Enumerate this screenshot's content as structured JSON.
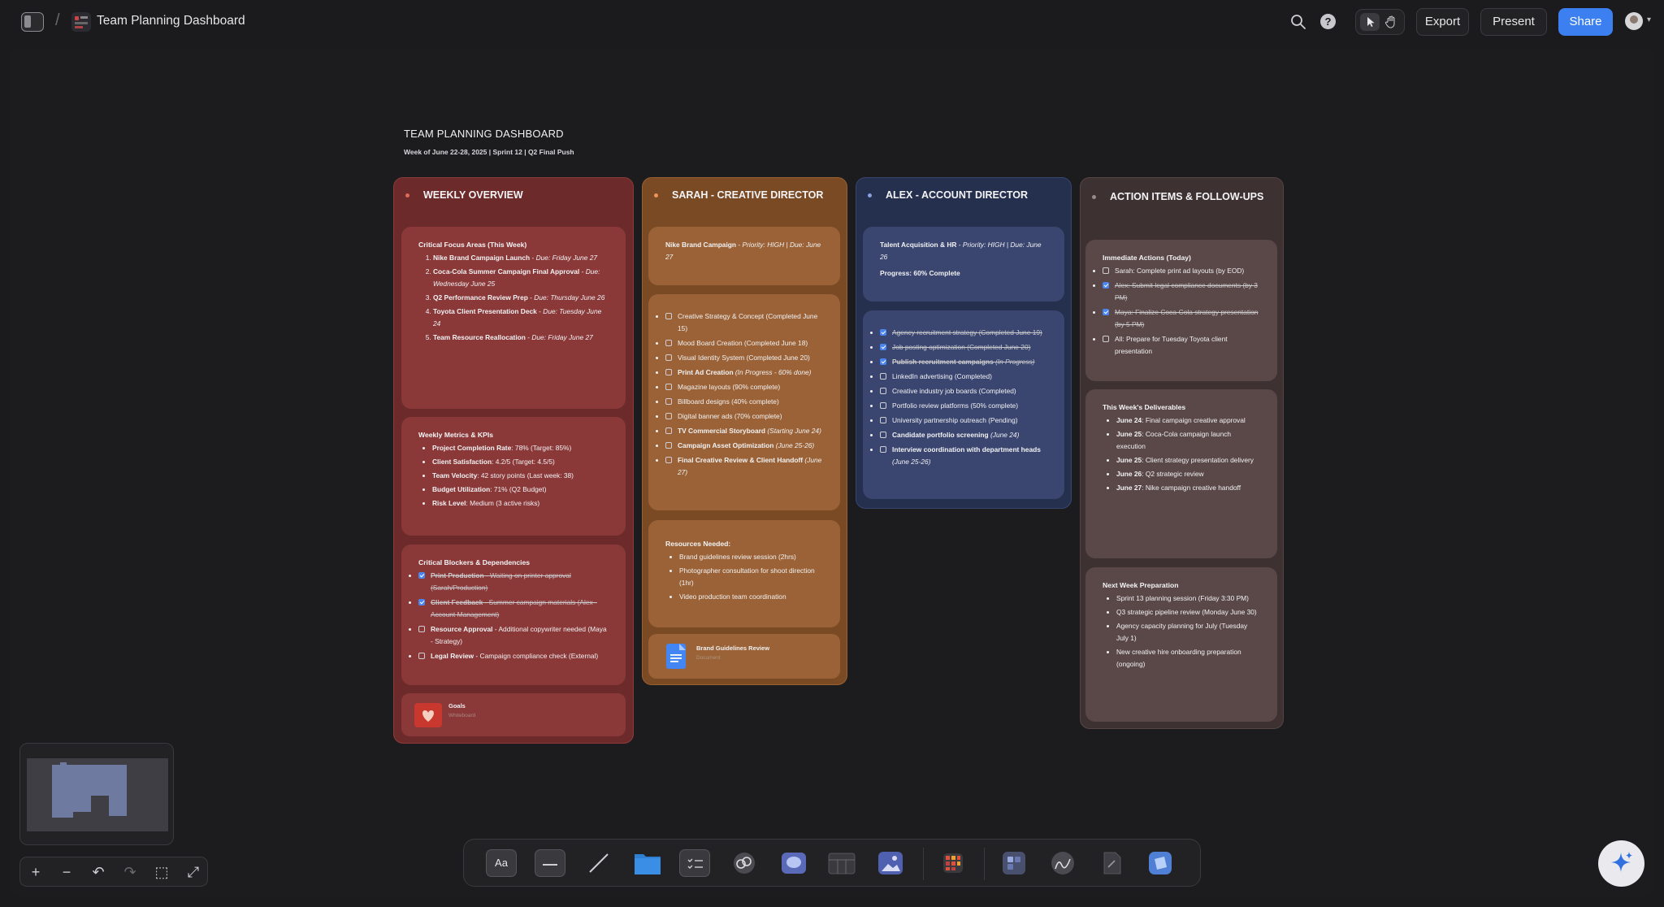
{
  "topbar": {
    "title": "Team Planning Dashboard",
    "export_label": "Export",
    "present_label": "Present",
    "share_label": "Share",
    "icons": [
      "sidebar-toggle-icon",
      "file-thumbnail-icon",
      "search-icon",
      "help-icon",
      "pointer-icon",
      "hand-icon",
      "avatar",
      "chevron-down-icon"
    ]
  },
  "doc": {
    "title": "TEAM PLANNING DASHBOARD",
    "subtitle": "Week of June 22-28, 2025 | Sprint 12 | Q2 Final Push"
  },
  "columns": {
    "weekly": {
      "header": "WEEKLY OVERVIEW",
      "color": "#6e2a2a",
      "card1": {
        "heading": "Critical Focus Areas (This Week)",
        "items": [
          {
            "bold": "Nike Brand Campaign Launch",
            "sep": " - ",
            "ital": "Due: Friday June 27"
          },
          {
            "bold": "Coca-Cola Summer Campaign Final Approval",
            "sep": " - ",
            "ital": "Due: Wednesday June 25"
          },
          {
            "bold": "Q2 Performance Review Prep",
            "sep": " - ",
            "ital": "Due: Thursday June 26"
          },
          {
            "bold": "Toyota Client Presentation Deck",
            "sep": " - ",
            "ital": "Due: Tuesday June 24"
          },
          {
            "bold": "Team Resource Reallocation",
            "sep": " - ",
            "ital": "Due: Friday June 27"
          }
        ]
      },
      "card2": {
        "heading": "Weekly Metrics & KPIs",
        "items": [
          {
            "bold": "Project Completion Rate",
            "rest": ": 78% (Target: 85%)"
          },
          {
            "bold": "Client Satisfaction",
            "rest": ": 4.2/5 (Target: 4.5/5)"
          },
          {
            "bold": "Team Velocity",
            "rest": ": 42 story points (Last week: 38)"
          },
          {
            "bold": "Budget Utilization",
            "rest": ": 71% (Q2 Budget)"
          },
          {
            "bold": "Risk Level",
            "rest": ": Medium (3 active risks)"
          }
        ]
      },
      "card3": {
        "heading": "Critical Blockers & Dependencies",
        "items": [
          {
            "bold": "Print Production",
            "rest": " - Waiting on printer approval (Sarah/Production)",
            "done": true
          },
          {
            "bold": "Client Feedback",
            "rest": " - Summer campaign materials (Alex - Account Management)",
            "done": true
          },
          {
            "bold": "Resource Approval",
            "rest": " - Additional copywriter needed (Maya - Strategy)",
            "done": false
          },
          {
            "bold": "Legal Review",
            "rest": " - Campaign compliance check (External)",
            "done": false
          }
        ]
      },
      "embed": {
        "name": "Goals",
        "kind": "Whiteboard"
      }
    },
    "sarah": {
      "header": "SARAH - CREATIVE DIRECTOR",
      "color": "#7a4a26",
      "card1": {
        "bold": "Nike Brand Campaign",
        "sep": " - ",
        "ital": "Priority: HIGH | Due: June 27"
      },
      "tasks": [
        {
          "bold": "",
          "rest": "Creative Strategy & Concept (Completed June 15)",
          "ital": ""
        },
        {
          "bold": "",
          "rest": "Mood Board Creation (Completed June 18)",
          "ital": ""
        },
        {
          "bold": "",
          "rest": "Visual Identity System (Completed June 20)",
          "ital": ""
        },
        {
          "bold": "Print Ad Creation",
          "rest": " ",
          "ital": "(In Progress - 60% done)"
        },
        {
          "bold": "",
          "rest": "Magazine layouts (90% complete)",
          "ital": ""
        },
        {
          "bold": "",
          "rest": "Billboard designs (40% complete)",
          "ital": ""
        },
        {
          "bold": "",
          "rest": "Digital banner ads (70% complete)",
          "ital": ""
        },
        {
          "bold": "TV Commercial Storyboard",
          "rest": " ",
          "ital": "(Starting June 24)"
        },
        {
          "bold": "Campaign Asset Optimization",
          "rest": " ",
          "ital": "(June 25-26)"
        },
        {
          "bold": "Final Creative Review & Client Handoff",
          "rest": " ",
          "ital": "(June 27)"
        }
      ],
      "resources": {
        "heading": "Resources Needed:",
        "items": [
          "Brand guidelines review session (2hrs)",
          "Photographer consultation for shoot direction (1hr)",
          "Video production team coordination"
        ]
      },
      "embed": {
        "name": "Brand Guidelines Review",
        "kind": "Document"
      }
    },
    "alex": {
      "header": "ALEX - ACCOUNT DIRECTOR",
      "color": "#262f4d",
      "card1": {
        "bold": "Talent Acquisition & HR",
        "sep": " - ",
        "ital": "Priority: HIGH | Due: June 26",
        "progress": "Progress: 60% Complete"
      },
      "tasks": [
        {
          "bold": "",
          "rest": "Agency recruitment strategy (Completed June 19)",
          "ital": "",
          "done": true
        },
        {
          "bold": "",
          "rest": "Job posting optimization (Completed June 20)",
          "ital": "",
          "done": true
        },
        {
          "bold": "Publish recruitment campaigns",
          "rest": " ",
          "ital": "(In Progress)",
          "done": true
        },
        {
          "bold": "",
          "rest": "LinkedIn advertising (Completed)",
          "ital": "",
          "done": false
        },
        {
          "bold": "",
          "rest": "Creative industry job boards (Completed)",
          "ital": "",
          "done": false
        },
        {
          "bold": "",
          "rest": "Portfolio review platforms (50% complete)",
          "ital": "",
          "done": false
        },
        {
          "bold": "",
          "rest": "University partnership outreach (Pending)",
          "ital": "",
          "done": false
        },
        {
          "bold": "Candidate portfolio screening",
          "rest": " ",
          "ital": "(June 24)",
          "done": false
        },
        {
          "bold": "Interview coordination with department heads",
          "rest": " ",
          "ital": "(June 25-26)",
          "done": false
        }
      ]
    },
    "actions": {
      "header": "ACTION ITEMS & FOLLOW-UPS",
      "color": "#3e3030",
      "immediate": {
        "heading": "Immediate Actions (Today)",
        "items": [
          {
            "text": "Sarah: Complete print ad layouts (by EOD)",
            "done": false
          },
          {
            "text": "Alex: Submit legal compliance documents (by 3 PM)",
            "done": true
          },
          {
            "text": "Maya: Finalize Coca-Cola strategy presentation (by 5 PM)",
            "done": true
          },
          {
            "text": "All: Prepare for Tuesday Toyota client presentation",
            "done": false
          }
        ]
      },
      "deliverables": {
        "heading": "This Week's Deliverables",
        "items": [
          {
            "bold": "June 24",
            "rest": ": Final campaign creative approval"
          },
          {
            "bold": "June 25",
            "rest": ": Coca-Cola campaign launch execution"
          },
          {
            "bold": "June 25",
            "rest": ": Client strategy presentation delivery"
          },
          {
            "bold": "June 26",
            "rest": ": Q2 strategic review"
          },
          {
            "bold": "June 27",
            "rest": ": Nike campaign creative handoff"
          }
        ]
      },
      "nextweek": {
        "heading": "Next Week Preparation",
        "items": [
          "Sprint 13 planning session (Friday 3:30 PM)",
          "Q3 strategic pipeline review (Monday June 30)",
          "Agency capacity planning for July (Tuesday July 1)",
          "New creative hire onboarding preparation (ongoing)"
        ]
      }
    }
  },
  "zoom_controls": {
    "zoom_in": "+",
    "zoom_out": "−",
    "undo": "↶",
    "redo": "↷",
    "fit": "⬚",
    "fullscreen": "⤢"
  },
  "toolbar": {
    "text_tool": "Aa",
    "tools": [
      "text-tool",
      "sticky-tool",
      "line-tool",
      "folder-tool",
      "checklist-tool",
      "link-tool",
      "comment-tool",
      "table-tool",
      "image-tool",
      "apps-tool",
      "widget-tool",
      "draw-tool",
      "document-tool",
      "ai-shape-tool"
    ]
  }
}
